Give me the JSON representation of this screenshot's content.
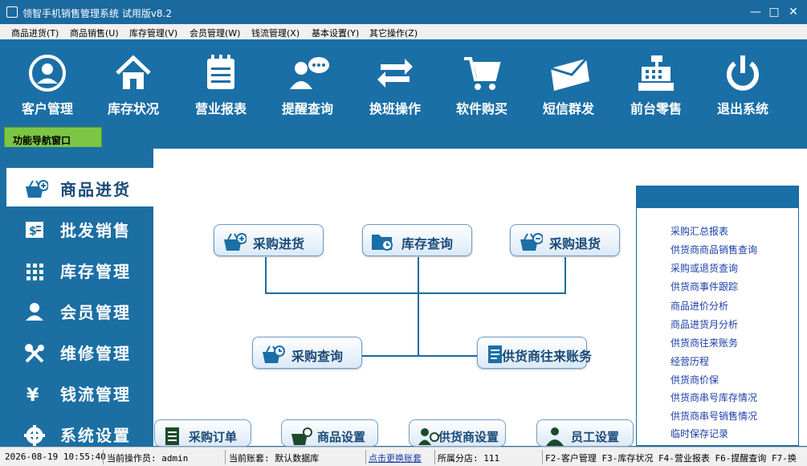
{
  "window": {
    "title": "领智手机销售管理系统 试用版v8.2"
  },
  "menu": [
    "商品进货(T)",
    "商品销售(U)",
    "库存管理(V)",
    "会员管理(W)",
    "钱流管理(X)",
    "基本设置(Y)",
    "其它操作(Z)"
  ],
  "toolbar": [
    "客户管理",
    "库存状况",
    "营业报表",
    "提醒查询",
    "换班操作",
    "软件购买",
    "短信群发",
    "前台零售",
    "退出系统"
  ],
  "nav_tab": "功能导航窗口",
  "left_nav": [
    "商品进货",
    "批发销售",
    "库存管理",
    "会员管理",
    "维修管理",
    "钱流管理",
    "系统设置"
  ],
  "flow": {
    "purchase_in": "采购进货",
    "stock_query": "库存查询",
    "purchase_return": "采购退货",
    "purchase_query": "采购查询",
    "supplier_accounts": "供货商往来账务"
  },
  "bottom_buttons": [
    "采购订单",
    "商品设置",
    "供货商设置",
    "员工设置"
  ],
  "right_links": [
    "采购汇总报表",
    "供货商商品销售查询",
    "采购或退货查询",
    "供货商事件跟踪",
    "商品进价分析",
    "商品进货月分析",
    "供货商往来账务",
    "经营历程",
    "供货商价保",
    "供货商串号库存情况",
    "供货商串号销售情况",
    "临时保存记录"
  ],
  "status": {
    "datetime": "2026-08-19 10:55:40",
    "operator": "当前操作员: admin",
    "account": "当前账套: 默认数据库",
    "switch_link": "点击更换账套",
    "branch": "所属分店: 111",
    "shortcuts": "F2-客户管理 F3-库存状况 F4-营业报表 F6-提醒查询 F7-换"
  },
  "colors": {
    "primary": "#1b6fa3",
    "tab_green": "#7bc642",
    "link": "#1a3ea8"
  }
}
